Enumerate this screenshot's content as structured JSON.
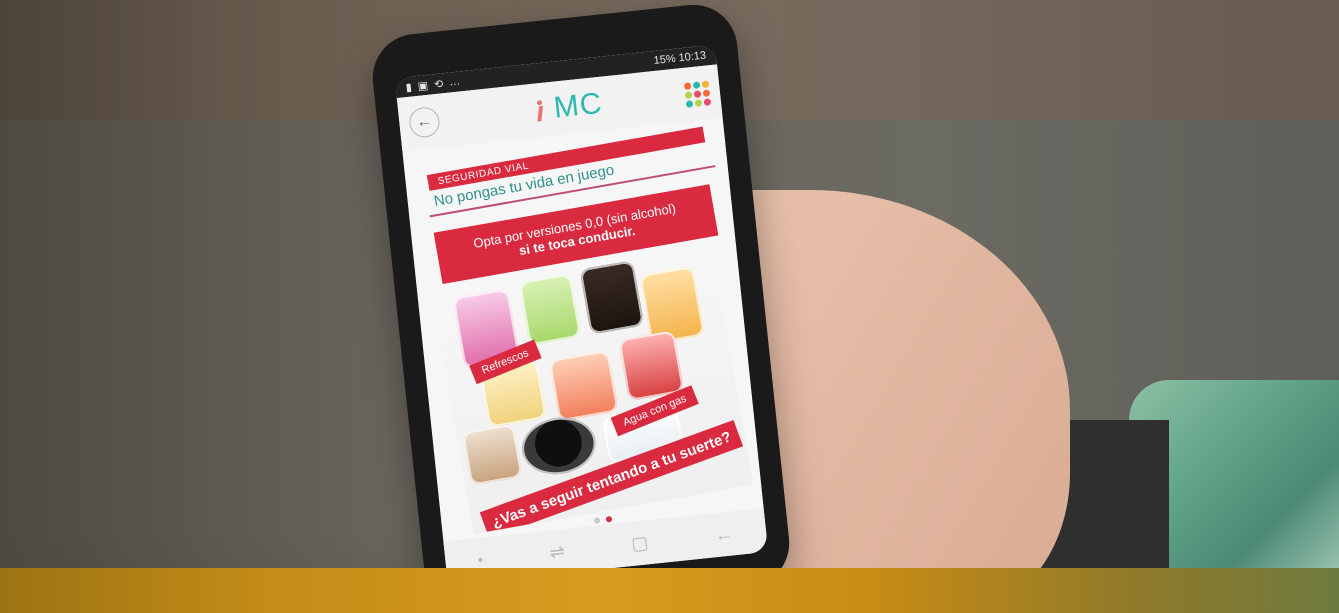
{
  "status_bar": {
    "left_icons": [
      "signal-icon",
      "battery-saver-icon",
      "sync-icon",
      "more-dots-icon"
    ],
    "right_text": "15% 10:13"
  },
  "app": {
    "logo_text": "MC",
    "back_icon": "back-arrow-icon",
    "palette": {
      "teal": "#2bb9b0",
      "red": "#d92a3f",
      "pink_rule": "#c14d73",
      "gray": "#f2f2f2"
    }
  },
  "content": {
    "section_label": "SEGURIDAD VIAL",
    "headline": "No pongas tu vida en juego",
    "promo_line1": "Opta por versiones 0,0 (sin alcohol)",
    "promo_line2": "si te toca conducir.",
    "image_labels": {
      "refrescos": "Refrescos",
      "agua": "Agua con gas"
    },
    "bottom_ribbon": "¿Vas a seguir tentando a tu suerte?"
  },
  "pager": {
    "count": 2,
    "active_index": 1
  },
  "navigation": {
    "icons": [
      "recent-apps-icon",
      "home-icon",
      "back-icon"
    ]
  }
}
